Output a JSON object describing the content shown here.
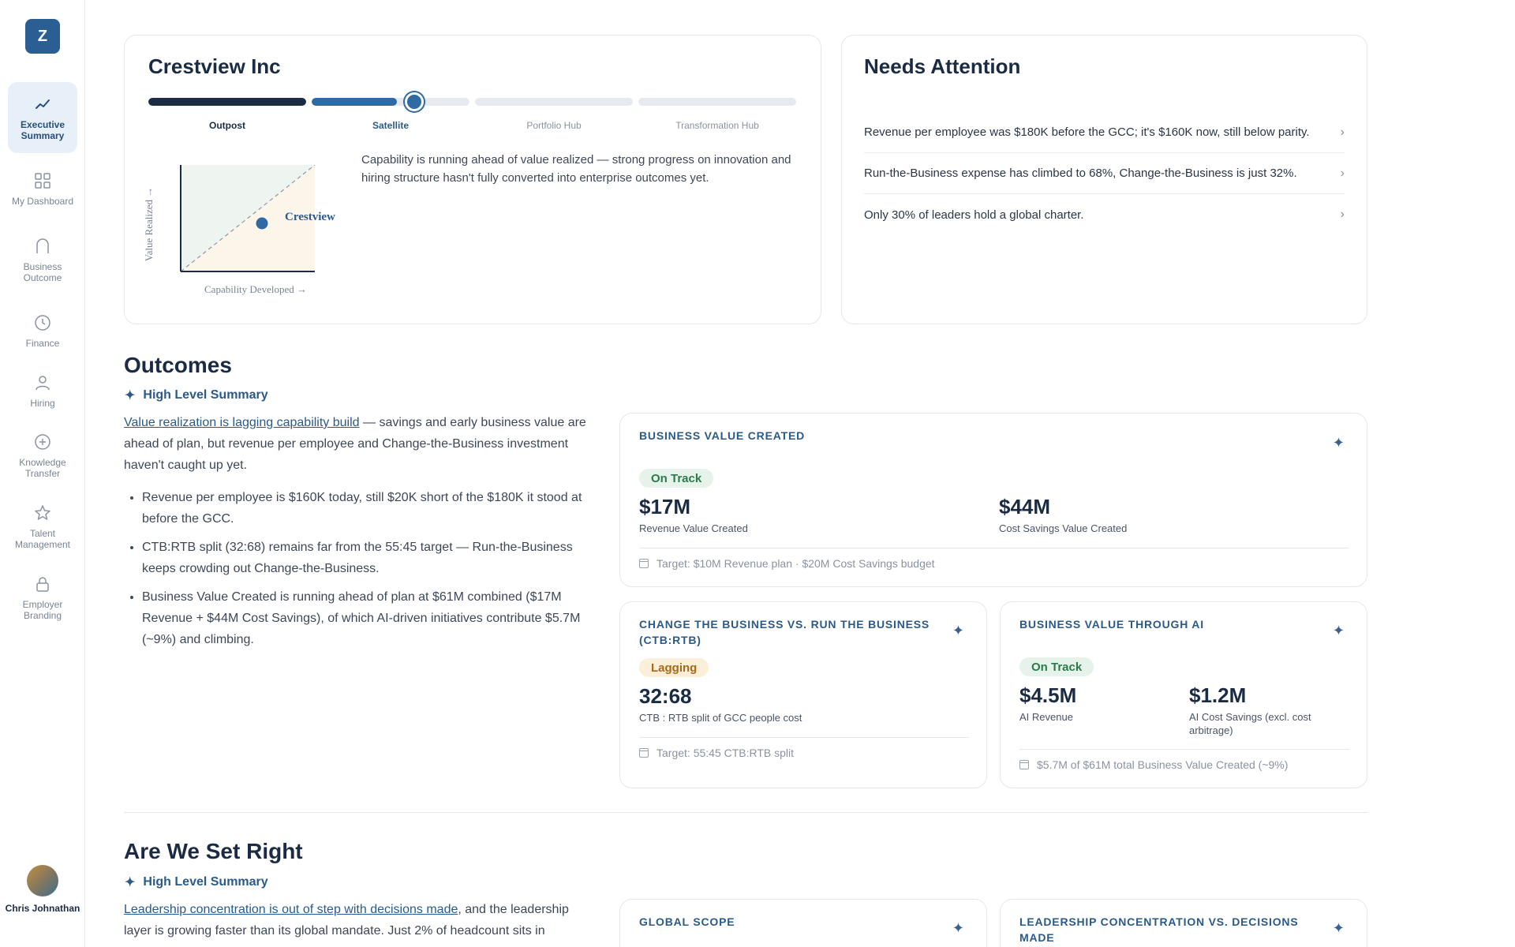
{
  "sidebar": {
    "logo": "Z",
    "items": [
      {
        "label": "Executive Summary",
        "icon": "trend-line-icon",
        "active": true
      },
      {
        "label": "My Dashboard",
        "icon": "grid-icon"
      },
      {
        "label": "Business Outcome",
        "icon": "arch-icon"
      },
      {
        "label": "Finance",
        "icon": "clock-icon"
      },
      {
        "label": "Hiring",
        "icon": "person-icon"
      },
      {
        "label": "Knowledge Transfer",
        "icon": "plus-circle-icon"
      },
      {
        "label": "Talent Management",
        "icon": "star-icon"
      },
      {
        "label": "Employer Branding",
        "icon": "lock-icon"
      }
    ],
    "user": {
      "name": "Chris Johnathan"
    }
  },
  "company": {
    "name": "Crestview Inc",
    "stages": [
      "Outpost",
      "Satellite",
      "Portfolio Hub",
      "Transformation Hub"
    ],
    "current_stage": "Satellite",
    "matrix": {
      "y_label": "Value Realized →",
      "x_label": "Capability Developed →",
      "point_label": "Crestview"
    },
    "description": "Capability is running ahead of value realized — strong progress on innovation and hiring structure hasn't fully converted into enterprise outcomes yet."
  },
  "attention": {
    "title": "Needs Attention",
    "items": [
      "Revenue per employee was $180K before the GCC; it's $160K now, still below parity.",
      "Run-the-Business expense has climbed to 68%, Change-the-Business is just 32%.",
      "Only 30% of leaders hold a global charter."
    ]
  },
  "outcomes": {
    "title": "Outcomes",
    "summary_label": "High Level Summary",
    "lead_link": "Value realization is lagging capability build",
    "lead_rest": " — savings and early business value are ahead of plan, but revenue per employee and Change-the-Business investment haven't caught up yet.",
    "bullets": [
      "Revenue per employee is $160K today, still $20K short of the $180K it stood at before the GCC.",
      "CTB:RTB split (32:68) remains far from the 55:45 target — Run-the-Business keeps crowding out Change-the-Business.",
      "Business Value Created is running ahead of plan at $61M combined ($17M Revenue + $44M Cost Savings), of which AI-driven initiatives contribute $5.7M (~9%) and climbing."
    ],
    "bvc": {
      "title": "BUSINESS VALUE CREATED",
      "status": "On Track",
      "m1_value": "$17M",
      "m1_label": "Revenue Value Created",
      "m2_value": "$44M",
      "m2_label": "Cost Savings Value Created",
      "target": "Target: $10M Revenue plan · $20M Cost Savings budget"
    },
    "ctb": {
      "title": "CHANGE THE BUSINESS VS. RUN THE BUSINESS (CTB:RTB)",
      "status": "Lagging",
      "value": "32:68",
      "label": "CTB : RTB split of GCC people cost",
      "target": "Target: 55:45 CTB:RTB split"
    },
    "ai": {
      "title": "BUSINESS VALUE THROUGH AI",
      "status": "On Track",
      "m1_value": "$4.5M",
      "m1_label": "AI Revenue",
      "m2_value": "$1.2M",
      "m2_label": "AI Cost Savings (excl. cost arbitrage)",
      "note": "$5.7M of $61M total Business Value Created (~9%)"
    }
  },
  "setright": {
    "title": "Are We Set Right",
    "summary_label": "High Level Summary",
    "lead_link": "Leadership concentration is out of step with decisions made",
    "lead_rest": ", and the leadership layer is growing faster than its global mandate. Just 2% of headcount sits in",
    "card1_title": "GLOBAL SCOPE",
    "card2_title": "LEADERSHIP CONCENTRATION VS. DECISIONS MADE"
  },
  "colors": {
    "brand": "#2b5f93",
    "navy": "#1b2b44",
    "accent": "#2b5a8a",
    "green": "#2b7a4b",
    "amber": "#a76a14"
  }
}
